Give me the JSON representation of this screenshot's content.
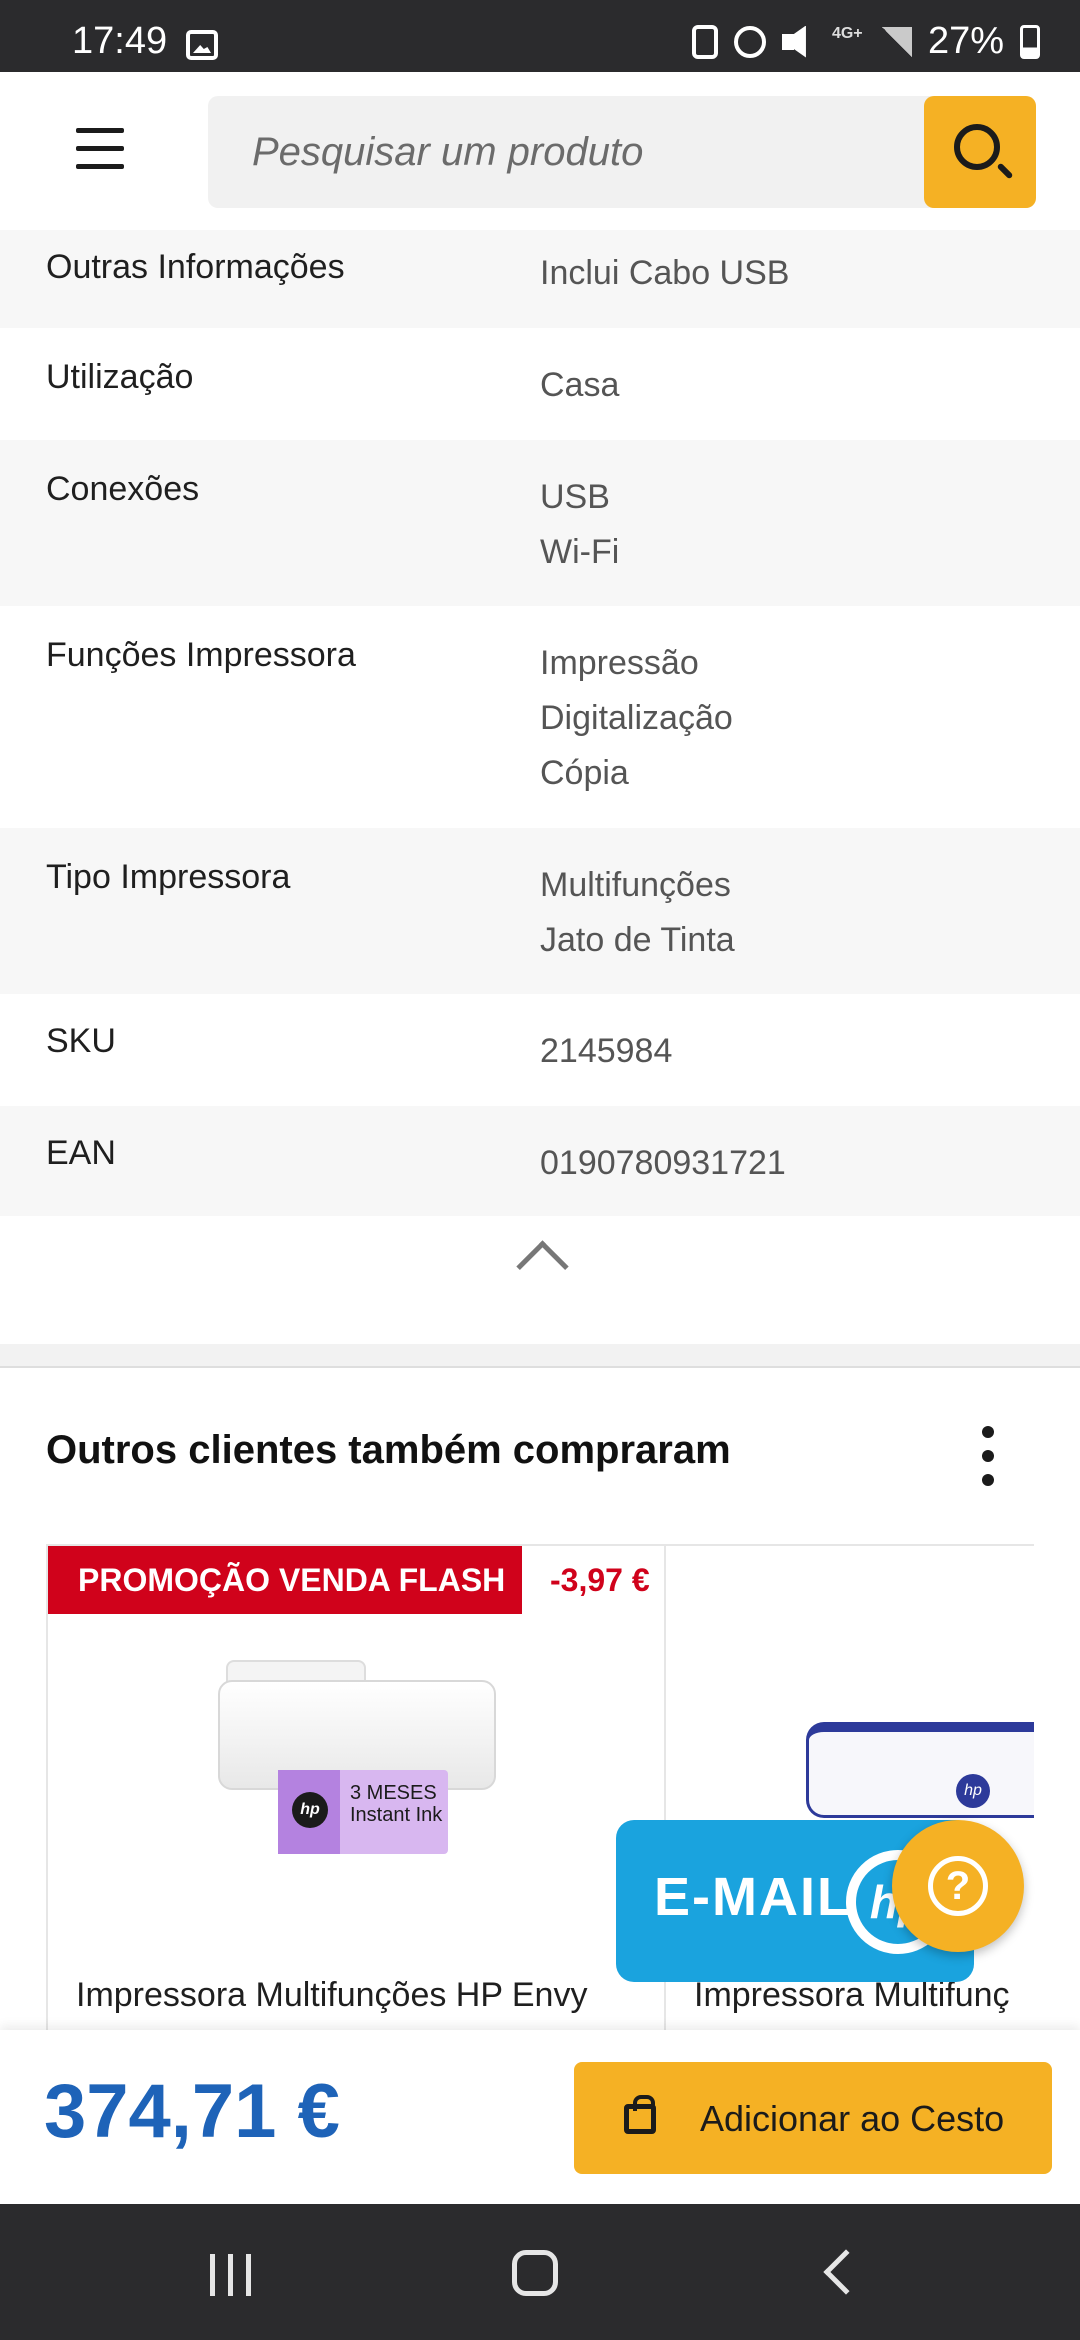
{
  "status_bar": {
    "time": "17:49",
    "network": "4G+",
    "battery": "27%",
    "icons": [
      "gallery-icon",
      "clipboard-icon",
      "alarm-icon",
      "mute-icon",
      "network-icon",
      "signal-icon",
      "battery-icon"
    ]
  },
  "header": {
    "search_placeholder": "Pesquisar um produto",
    "accent_color": "#f5b124"
  },
  "specs": [
    {
      "label": "Outras Informações",
      "values": [
        "Inclui Cabo USB"
      ]
    },
    {
      "label": "Utilização",
      "values": [
        "Casa"
      ]
    },
    {
      "label": "Conexões",
      "values": [
        "USB",
        "Wi-Fi"
      ]
    },
    {
      "label": "Funções Impressora",
      "values": [
        "Impressão",
        "Digitalização",
        "Cópia"
      ]
    },
    {
      "label": "Tipo Impressora",
      "values": [
        "Multifunções",
        "Jato de Tinta"
      ]
    },
    {
      "label": "SKU",
      "values": [
        "2145984"
      ]
    },
    {
      "label": "EAN",
      "values": [
        "0190780931721"
      ]
    }
  ],
  "recommendations": {
    "title": "Outros clientes também compraram",
    "products": [
      {
        "badge": "PROMOÇÃO VENDA FLASH",
        "discount": "-3,97 €",
        "image_caption": "3 MESES Instant Ink",
        "logo": "hp",
        "name": "Impressora Multifunções HP Envy"
      },
      {
        "logo": "hp",
        "name": "Impressora Multifunç"
      }
    ]
  },
  "floating": {
    "email_banner": "E-MAIL",
    "email_logo": "hp",
    "help_glyph": "?",
    "banner_color": "#1aa3de"
  },
  "buy_bar": {
    "price": "374,71 €",
    "add_to_cart": "Adicionar ao Cesto",
    "price_color": "#1e63b8"
  }
}
